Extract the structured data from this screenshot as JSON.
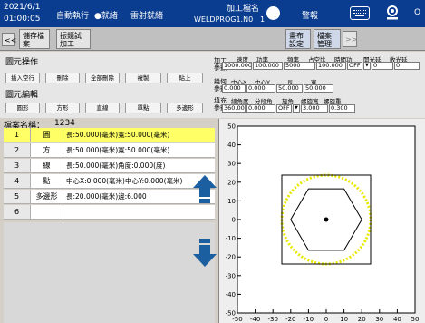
{
  "status_bar": {
    "date": "2021/6/1",
    "time": "01:00:05",
    "mode": "自動執行",
    "state": "●就緒",
    "laser": "雷射就緒",
    "job_name_label": "加工檔名",
    "job_name": "WELDPROG1.N0",
    "job_index": "1",
    "alarm": "警報",
    "indicator_color": "#ffffff"
  },
  "toolbar": {
    "collapse": "<<",
    "save": "儲存檔案",
    "test": "振鏡試加工",
    "layout": "畫布設定",
    "file_mgmt": "檔案管理",
    "expand": ">>"
  },
  "elem_ops": {
    "title": "圖元操作",
    "buttons": [
      "插入空行",
      "刪除",
      "全部刪除",
      "複製",
      "貼上"
    ]
  },
  "elem_edit": {
    "title": "圖元編輯",
    "buttons": [
      "圓形",
      "方形",
      "直線",
      "單點",
      "多邊形"
    ]
  },
  "params": {
    "process_label": "加工參數",
    "process_headers": [
      "速度",
      "功率",
      "頻率",
      "占空比",
      "時間功",
      "開光延",
      "收光延"
    ],
    "process_values": [
      "1000.000",
      "100.000",
      "5000",
      "100.000",
      "OFF",
      "0",
      "0"
    ],
    "geometry_label": "幾何參數",
    "geometry_headers": [
      "中心X",
      "中心Y",
      "長",
      "寬"
    ],
    "geometry_values": [
      "0.000",
      "0.000",
      "50.000",
      "50.000"
    ],
    "fill_label": "填充參數",
    "fill_headers": [
      "總角度",
      "分段角",
      "旋角",
      "螺旋寬",
      "螺旋重"
    ],
    "fill_values": [
      "360.000",
      "0.000",
      "OFF",
      "3.000",
      "0.300"
    ]
  },
  "file": {
    "label": "檔案名稱：",
    "name": "1234"
  },
  "table": {
    "rows": [
      {
        "num": "1",
        "type": "圓",
        "desc": "長:50.000(毫米)寬:50.000(毫米)"
      },
      {
        "num": "2",
        "type": "方",
        "desc": "長:50.000(毫米)寬:50.000(毫米)"
      },
      {
        "num": "3",
        "type": "線",
        "desc": "長:50.000(毫米)角度:0.000(度)"
      },
      {
        "num": "4",
        "type": "點",
        "desc": "中心X:0.000(毫米)中心Y:0.000(毫米)"
      },
      {
        "num": "5",
        "type": "多邊形",
        "desc": "長:20.000(毫米)邊:6.000"
      },
      {
        "num": "6",
        "type": "",
        "desc": ""
      }
    ]
  },
  "chart_data": {
    "type": "scatter",
    "title": "",
    "xlabel": "",
    "ylabel": "",
    "xlim": [
      -50,
      50
    ],
    "ylim": [
      -50,
      50
    ],
    "x_ticks": [
      "-50",
      "-40",
      "-30",
      "-20",
      "-10",
      "0",
      "10",
      "20",
      "30",
      "40",
      "50"
    ],
    "y_ticks": [
      "50",
      "40",
      "30",
      "20",
      "10",
      "0",
      "-10",
      "-20",
      "-30",
      "-40",
      "-50"
    ],
    "series": [
      {
        "shape": "circle",
        "center": [
          0,
          0
        ],
        "radius": 25,
        "color": "#e8e800"
      },
      {
        "shape": "square",
        "center": [
          0,
          0
        ],
        "side": 50,
        "color": "#000000"
      },
      {
        "shape": "hexagon",
        "center": [
          0,
          0
        ],
        "radius": 20,
        "color": "#000000"
      },
      {
        "shape": "point",
        "center": [
          0,
          0
        ],
        "color": "#000000"
      }
    ],
    "grid": false
  },
  "colors": {
    "title_bg": "#0a3d8f",
    "selected_row": "#ffff66",
    "arrow": "#1c5fa0",
    "canvas_bg": "#eeeeee"
  }
}
